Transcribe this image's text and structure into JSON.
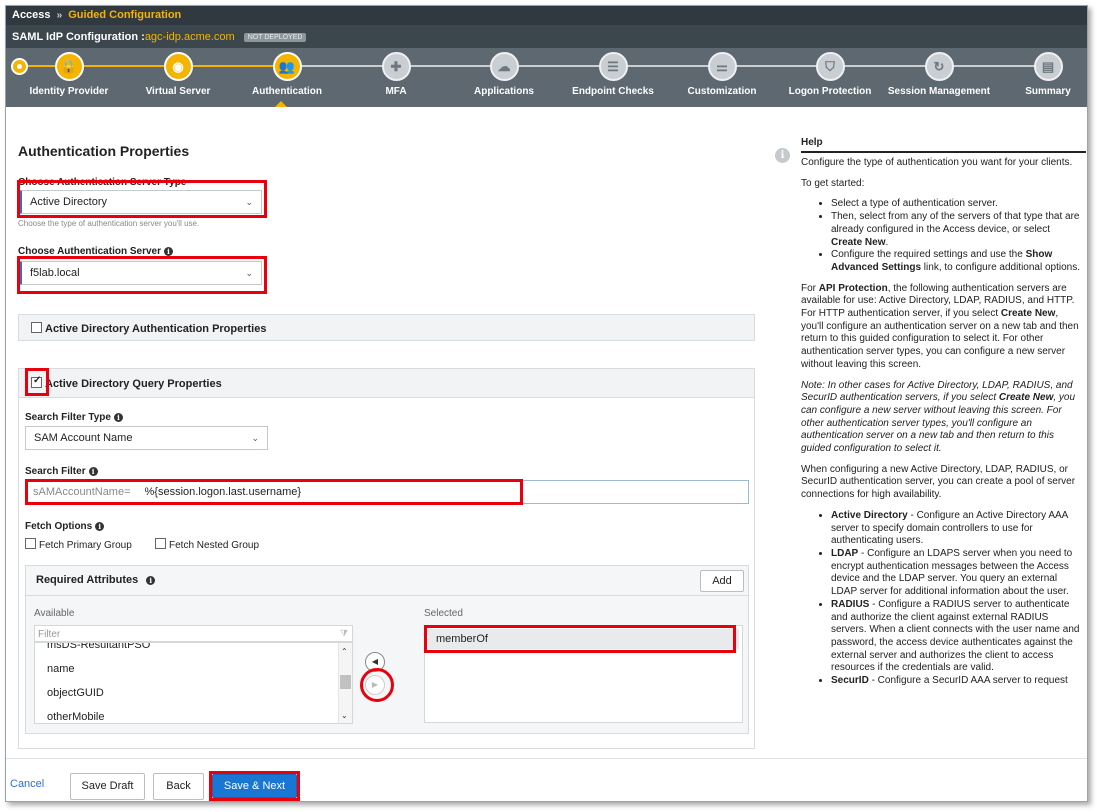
{
  "breadcrumb": {
    "root": "Access",
    "separator": "»",
    "current": "Guided Configuration"
  },
  "config": {
    "label": "SAML IdP Configuration :",
    "host": "agc-idp.acme.com",
    "status": "NOT DEPLOYED"
  },
  "steps": [
    {
      "label": "Identity Provider",
      "state": "done",
      "icon": "lock-icon",
      "glyph": "🔒"
    },
    {
      "label": "Virtual Server",
      "state": "done",
      "icon": "target-icon",
      "glyph": "◉"
    },
    {
      "label": "Authentication",
      "state": "current",
      "icon": "users-icon",
      "glyph": "👥"
    },
    {
      "label": "MFA",
      "state": "todo",
      "icon": "shield-key-icon",
      "glyph": "✚"
    },
    {
      "label": "Applications",
      "state": "todo",
      "icon": "cloud-icon",
      "glyph": "☁"
    },
    {
      "label": "Endpoint Checks",
      "state": "todo",
      "icon": "list-icon",
      "glyph": "☰"
    },
    {
      "label": "Customization",
      "state": "todo",
      "icon": "sliders-icon",
      "glyph": "⚌"
    },
    {
      "label": "Logon Protection",
      "state": "todo",
      "icon": "shield-icon",
      "glyph": "⛉"
    },
    {
      "label": "Session Management",
      "state": "todo",
      "icon": "timer-icon",
      "glyph": "↻"
    },
    {
      "label": "Summary",
      "state": "todo",
      "icon": "summary-icon",
      "glyph": "▤"
    }
  ],
  "main": {
    "title": "Authentication Properties",
    "server_type": {
      "label": "Choose Authentication Server Type",
      "value": "Active Directory",
      "hint": "Choose the type of authentication server you'll use."
    },
    "server": {
      "label": "Choose Authentication Server",
      "value": "f5lab.local"
    },
    "ad_auth_panel": {
      "label": "Active Directory Authentication Properties",
      "checked": false
    },
    "ad_query_panel": {
      "label": "Active Directory Query Properties",
      "checked": true
    },
    "search_filter_type": {
      "label": "Search Filter Type",
      "value": "SAM Account Name"
    },
    "search_filter": {
      "label": "Search Filter",
      "prefix": "sAMAccountName=",
      "value": "%{session.logon.last.username}"
    },
    "fetch_options": {
      "label": "Fetch Options",
      "primary_group": "Fetch Primary Group",
      "nested_group": "Fetch Nested Group"
    },
    "required_attributes": {
      "label": "Required Attributes",
      "add": "Add",
      "available_label": "Available",
      "filter_placeholder": "Filter",
      "available": [
        "msDS-ResultantPSO",
        "name",
        "objectGUID",
        "otherMobile"
      ],
      "selected_label": "Selected",
      "selected": [
        "memberOf"
      ]
    }
  },
  "footer": {
    "cancel": "Cancel",
    "save_draft": "Save Draft",
    "back": "Back",
    "save_next": "Save & Next"
  },
  "help": {
    "title": "Help",
    "intro": "Configure the type of authentication you want for your clients.",
    "get_started": "To get started:",
    "steps": {
      "s1": "Select a type of authentication server.",
      "s2a": "Then, select from any of the servers of that type that are already configured in the Access device, or select ",
      "s2b": "Create New",
      "s2c": ".",
      "s3a": "Configure the required settings and use the ",
      "s3b": "Show Advanced Settings",
      "s3c": " link, to configure additional options."
    },
    "api": {
      "a": "For ",
      "b": "API Protection",
      "c": ", the following authentication servers are available for use: Active Directory, LDAP, RADIUS, and HTTP. For HTTP authentication server, if you select ",
      "d": "Create New",
      "e": ", you'll configure an authentication server on a new tab and then return to this guided configuration to select it. For other authentication server types, you can configure a new server without leaving this screen."
    },
    "note": {
      "a": "Note: In other cases for Active Directory, LDAP, RADIUS, and SecurID authentication servers, if you select ",
      "b": "Create New",
      "c": ", you can configure a new server without leaving this screen. For other authentication server types, you'll configure an authentication server on a new tab and then return to this guided configuration to select it."
    },
    "pool": "When configuring a new Active Directory, LDAP, RADIUS, or SecurID authentication server, you can create a pool of server connections for high availability.",
    "servers": {
      "ad_name": "Active Directory",
      "ad_desc": " - Configure an Active Directory AAA server to specify domain controllers to use for authenticating users.",
      "ldap_name": "LDAP",
      "ldap_desc": " - Configure an LDAPS server when you need to encrypt authentication messages between the Access device and the LDAP server. You query an external LDAP server for additional information about the user.",
      "radius_name": "RADIUS",
      "radius_desc": " - Configure a RADIUS server to authenticate and authorize the client against external RADIUS servers. When a client connects with the user name and password, the access device authenticates against the external server and authorizes the client to access resources if the credentials are valid.",
      "securid_name": "SecurID",
      "securid_desc": " - Configure a SecurID AAA server to request"
    }
  },
  "colors": {
    "accent": "#f4b400",
    "header": "#30393f",
    "stepper": "#5e6870",
    "primary": "#1976d2",
    "highlight": "#e8000d"
  }
}
